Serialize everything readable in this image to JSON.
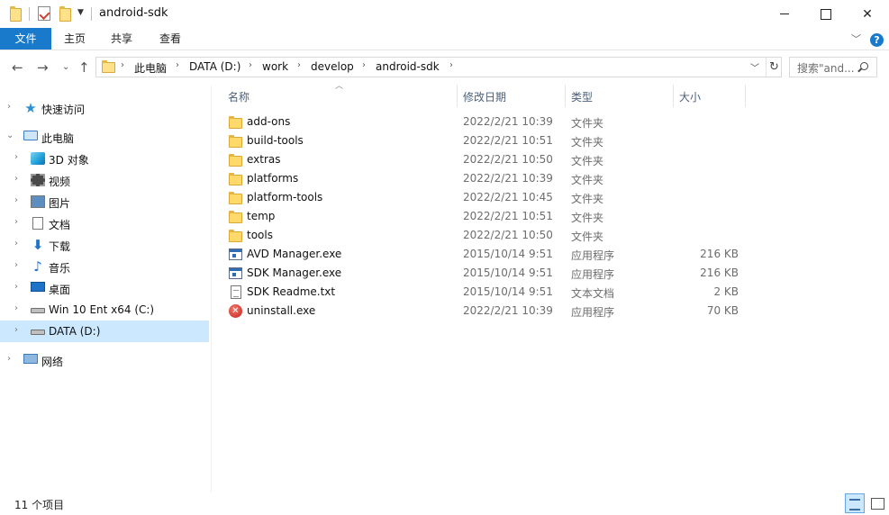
{
  "window": {
    "title": "android-sdk"
  },
  "ribbon": {
    "tabs": [
      "文件",
      "主页",
      "共享",
      "查看"
    ]
  },
  "address": {
    "crumbs": [
      "此电脑",
      "DATA (D:)",
      "work",
      "develop",
      "android-sdk"
    ]
  },
  "search": {
    "placeholder": "搜索\"and..."
  },
  "nav": {
    "items": [
      {
        "label": "快速访问",
        "icon": "quick-access-star-icon"
      },
      {
        "label": "此电脑",
        "icon": "this-pc-icon"
      },
      {
        "label": "3D 对象",
        "icon": "3d-objects-icon"
      },
      {
        "label": "视频",
        "icon": "videos-icon"
      },
      {
        "label": "图片",
        "icon": "pictures-icon"
      },
      {
        "label": "文档",
        "icon": "documents-icon"
      },
      {
        "label": "下载",
        "icon": "downloads-icon"
      },
      {
        "label": "音乐",
        "icon": "music-icon"
      },
      {
        "label": "桌面",
        "icon": "desktop-icon"
      },
      {
        "label": "Win 10 Ent x64 (C:)",
        "icon": "drive-c-icon"
      },
      {
        "label": "DATA (D:)",
        "icon": "drive-d-icon"
      },
      {
        "label": "网络",
        "icon": "network-icon"
      }
    ]
  },
  "columns": {
    "name": "名称",
    "date": "修改日期",
    "type": "类型",
    "size": "大小"
  },
  "files": [
    {
      "name": "add-ons",
      "date": "2022/2/21 10:39",
      "type": "文件夹",
      "size": "",
      "icon": "folder-icon"
    },
    {
      "name": "build-tools",
      "date": "2022/2/21 10:51",
      "type": "文件夹",
      "size": "",
      "icon": "folder-icon"
    },
    {
      "name": "extras",
      "date": "2022/2/21 10:50",
      "type": "文件夹",
      "size": "",
      "icon": "folder-icon"
    },
    {
      "name": "platforms",
      "date": "2022/2/21 10:39",
      "type": "文件夹",
      "size": "",
      "icon": "folder-icon"
    },
    {
      "name": "platform-tools",
      "date": "2022/2/21 10:45",
      "type": "文件夹",
      "size": "",
      "icon": "folder-icon"
    },
    {
      "name": "temp",
      "date": "2022/2/21 10:51",
      "type": "文件夹",
      "size": "",
      "icon": "folder-icon"
    },
    {
      "name": "tools",
      "date": "2022/2/21 10:50",
      "type": "文件夹",
      "size": "",
      "icon": "folder-icon"
    },
    {
      "name": "AVD Manager.exe",
      "date": "2015/10/14 9:51",
      "type": "应用程序",
      "size": "216 KB",
      "icon": "exe-icon"
    },
    {
      "name": "SDK Manager.exe",
      "date": "2015/10/14 9:51",
      "type": "应用程序",
      "size": "216 KB",
      "icon": "exe-icon"
    },
    {
      "name": "SDK Readme.txt",
      "date": "2015/10/14 9:51",
      "type": "文本文档",
      "size": "2 KB",
      "icon": "text-file-icon"
    },
    {
      "name": "uninstall.exe",
      "date": "2022/2/21 10:39",
      "type": "应用程序",
      "size": "70 KB",
      "icon": "uninstall-icon"
    }
  ],
  "status": {
    "count": "11 个项目"
  },
  "colors": {
    "accent": "#1979ca",
    "selection": "#cce8ff"
  }
}
